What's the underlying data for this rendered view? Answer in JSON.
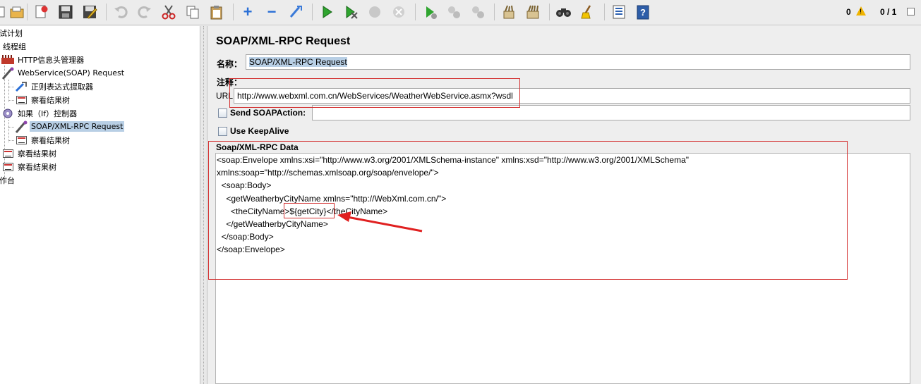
{
  "toolbar": {
    "icons": [
      "folder-open-icon",
      "template-icon",
      "save-icon",
      "save-as-icon",
      "undo-icon",
      "redo-icon",
      "cut-icon",
      "copy-icon",
      "paste-icon",
      "expand-icon",
      "collapse-icon",
      "toggle-icon",
      "start-icon",
      "start-no-pause-icon",
      "stop-icon",
      "shutdown-icon",
      "remote-start-icon",
      "remote-stop-icon",
      "remote-shutdown-icon",
      "clear-icon",
      "clear-all-icon",
      "search-icon",
      "reset-search-icon",
      "function-helper-icon",
      "help-icon"
    ],
    "error_count": "0",
    "thread_count": "0 / 1"
  },
  "tree": {
    "items": [
      {
        "label": "试计划",
        "icon": "test-plan-icon"
      },
      {
        "label": "线程组",
        "icon": "thread-group-icon"
      },
      {
        "label": "HTTP信息头管理器",
        "icon": "header-manager-icon"
      },
      {
        "label": "WebService(SOAP) Request",
        "icon": "sampler-icon"
      },
      {
        "label": "正则表达式提取器",
        "icon": "extractor-icon"
      },
      {
        "label": "察看结果树",
        "icon": "result-tree-icon"
      },
      {
        "label": "如果（If）控制器",
        "icon": "if-controller-icon"
      },
      {
        "label": "SOAP/XML-RPC Request",
        "icon": "sampler-icon"
      },
      {
        "label": "察看结果树",
        "icon": "result-tree-icon"
      },
      {
        "label": "察看结果树",
        "icon": "result-tree-icon"
      },
      {
        "label": "察看结果树",
        "icon": "result-tree-icon"
      },
      {
        "label": "作台",
        "icon": "workbench-icon"
      }
    ]
  },
  "panel": {
    "title": "SOAP/XML-RPC Request",
    "name_label": "名称：",
    "name_value": "SOAP/XML-RPC Request",
    "comment_label": "注释：",
    "comment_value": "",
    "url_label": "URL",
    "url_value": "http://www.webxml.com.cn/WebServices/WeatherWebService.asmx?wsdl",
    "send_soapaction_label": "Send SOAPAction:",
    "soapaction_value": "",
    "keepalive_label": "Use KeepAlive",
    "data_label": "Soap/XML-RPC Data",
    "xml_lines": [
      "<soap:Envelope xmlns:xsi=\"http://www.w3.org/2001/XMLSchema-instance\" xmlns:xsd=\"http://www.w3.org/2001/XMLSchema\"",
      "xmlns:soap=\"http://schemas.xmlsoap.org/soap/envelope/\">",
      "  <soap:Body>",
      "    <getWeatherbyCityName xmlns=\"http://WebXml.com.cn/\">",
      "      <theCityName>${getCity}</theCityName>",
      "    </getWeatherbyCityName>",
      "  </soap:Body>",
      "</soap:Envelope>"
    ],
    "xml_line5_prefix": "      <theCityName>",
    "xml_line5_var": "${getCity}",
    "xml_line5_suffix": "</theCityName>"
  },
  "colors": {
    "annotation_red": "#d32f2f",
    "selection_blue": "#b8cfe5"
  }
}
